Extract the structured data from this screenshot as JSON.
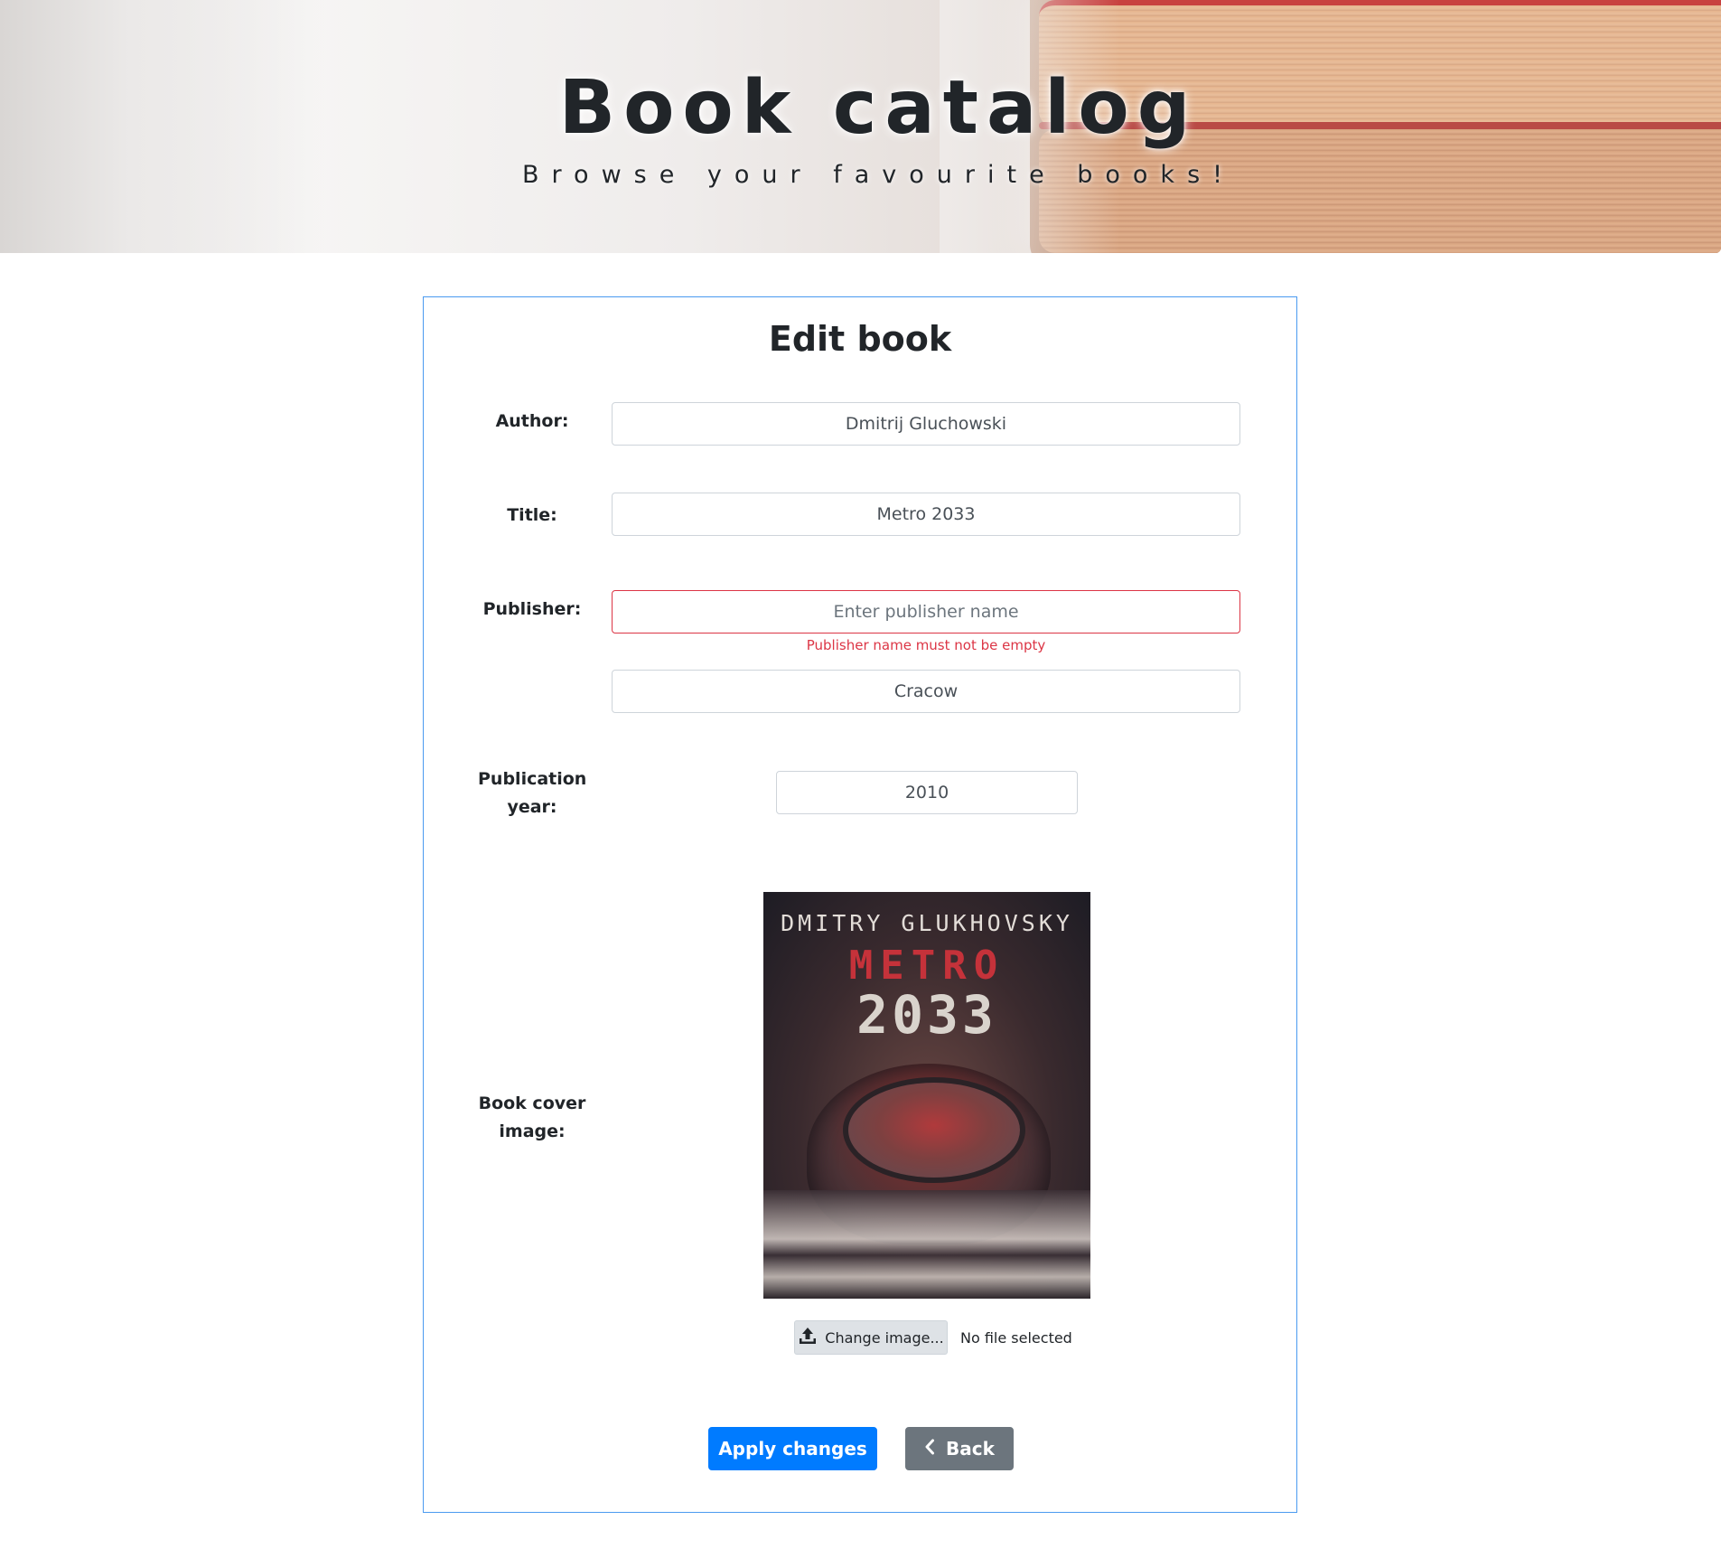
{
  "header": {
    "title": "Book catalog",
    "subtitle": "Browse your favourite books!"
  },
  "form": {
    "heading": "Edit book",
    "author": {
      "label": "Author:",
      "value": "Dmitrij Gluchowski"
    },
    "title": {
      "label": "Title:",
      "value": "Metro 2033"
    },
    "publisher": {
      "label": "Publisher:",
      "name_value": "",
      "name_placeholder": "Enter publisher name",
      "name_error": "Publisher name must not be empty",
      "city_value": "Cracow"
    },
    "publication_year": {
      "label": "Publication year:",
      "value": "2010"
    },
    "cover": {
      "label": "Book cover image:",
      "image_text": {
        "author": "DMITRY GLUKHOVSKY",
        "title_line1": "METRO",
        "title_line2": "2033"
      },
      "change_button_label": "Change image...",
      "change_button_icon": "upload-icon",
      "file_status": "No file selected"
    },
    "actions": {
      "apply_label": "Apply changes",
      "back_label": "Back",
      "back_icon": "chevron-left-icon"
    }
  },
  "colors": {
    "primary": "#007bff",
    "secondary": "#6c757d",
    "danger": "#dc3545",
    "card_border": "#4a9af0"
  }
}
